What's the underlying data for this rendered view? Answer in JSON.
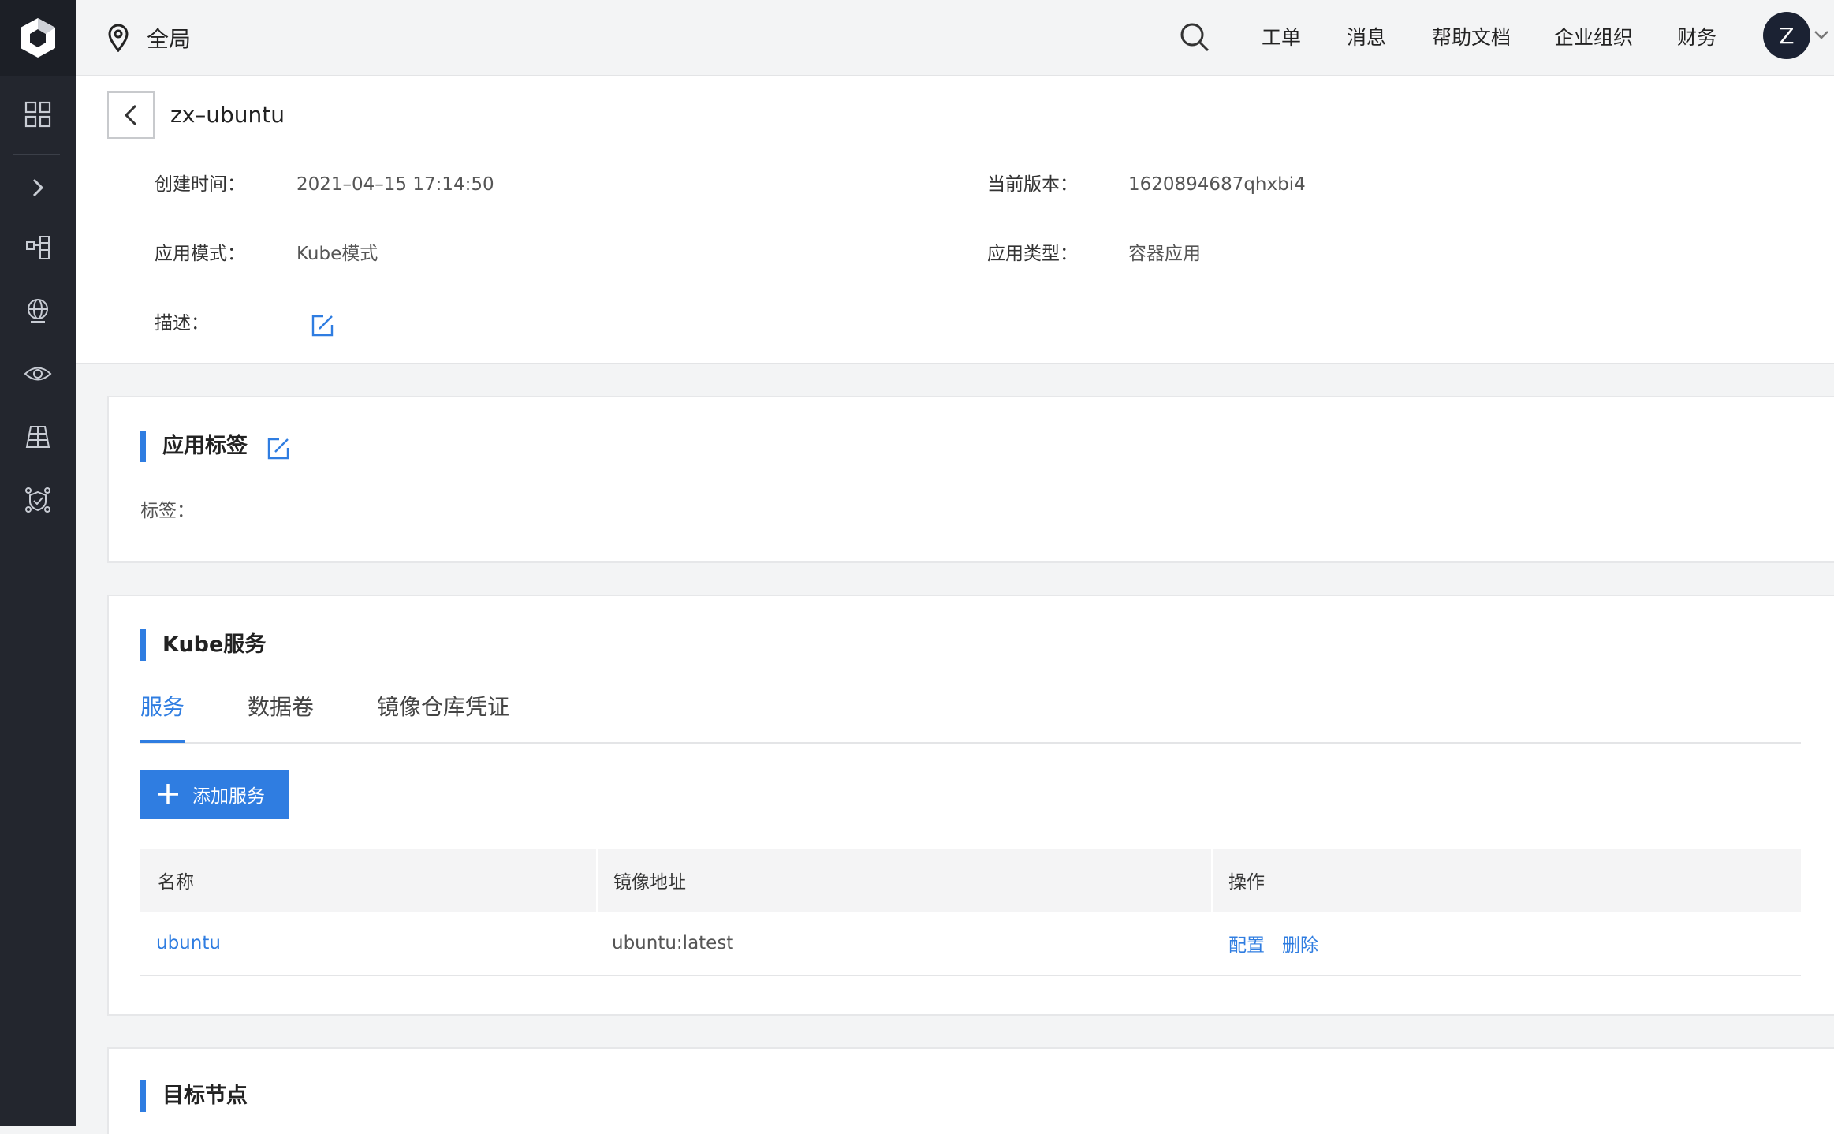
{
  "topbar": {
    "region_label": "全局",
    "nav": [
      "工单",
      "消息",
      "帮助文档",
      "企业组织",
      "财务"
    ],
    "avatar_letter": "Z"
  },
  "app": {
    "name": "zx–ubuntu",
    "created_label": "创建时间：",
    "created_value": "2021–04–15 17:14:50",
    "version_label": "当前版本：",
    "version_value": "1620894687qhxbi4",
    "mode_label": "应用模式：",
    "mode_value": "Kube模式",
    "type_label": "应用类型：",
    "type_value": "容器应用",
    "desc_label": "描述："
  },
  "labels_card": {
    "title": "应用标签",
    "tags_label": "标签："
  },
  "kube_card": {
    "title": "Kube服务",
    "tabs": [
      "服务",
      "数据卷",
      "镜像仓库凭证"
    ],
    "add_button": "添加服务",
    "columns": [
      "名称",
      "镜像地址",
      "操作"
    ],
    "rows": [
      {
        "name": "ubuntu",
        "image": "ubuntu:latest",
        "actions": [
          "配置",
          "删除"
        ]
      }
    ]
  },
  "target_card": {
    "title": "目标节点"
  },
  "colors": {
    "accent": "#2f7de1",
    "sidebar": "#23262e"
  }
}
